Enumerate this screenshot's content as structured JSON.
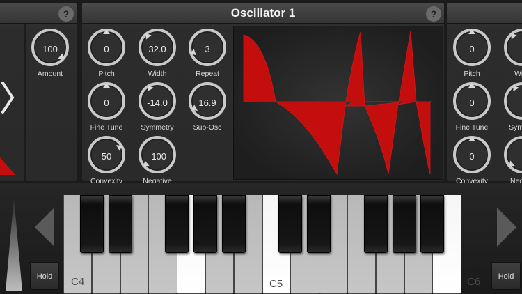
{
  "left_panel": {
    "help": "?",
    "knobs": [
      {
        "label": "Amount",
        "value": "100"
      }
    ]
  },
  "oscillator": {
    "title": "Oscillator 1",
    "help": "?",
    "knobs": [
      {
        "label": "Pitch",
        "value": "0"
      },
      {
        "label": "Width",
        "value": "32.0"
      },
      {
        "label": "Repeat",
        "value": "3"
      },
      {
        "label": "Fine Tune",
        "value": "0"
      },
      {
        "label": "Symmetry",
        "value": "-14.0"
      },
      {
        "label": "Sub-Osc",
        "value": "16.9"
      },
      {
        "label": "Convexity",
        "value": "50"
      },
      {
        "label": "Negative",
        "value": "-100"
      }
    ]
  },
  "right_panel": {
    "knobs": [
      {
        "label": "Pitch",
        "value": "0"
      },
      {
        "label": "Wi",
        "value": ""
      },
      {
        "label": "Fine Tune",
        "value": "0"
      },
      {
        "label": "Sym",
        "value": ""
      },
      {
        "label": "Convexity",
        "value": "0"
      },
      {
        "label": "Neg",
        "value": ""
      }
    ]
  },
  "keyboard": {
    "labels": {
      "c4": "C4",
      "c5": "C5",
      "c6": "C6"
    },
    "hold_left": "Hold",
    "hold_right": "Hold"
  },
  "colors": {
    "waveform": "#c40d0d",
    "knob_ring": "#c9c9c9",
    "panel": "#2c2c2c"
  }
}
